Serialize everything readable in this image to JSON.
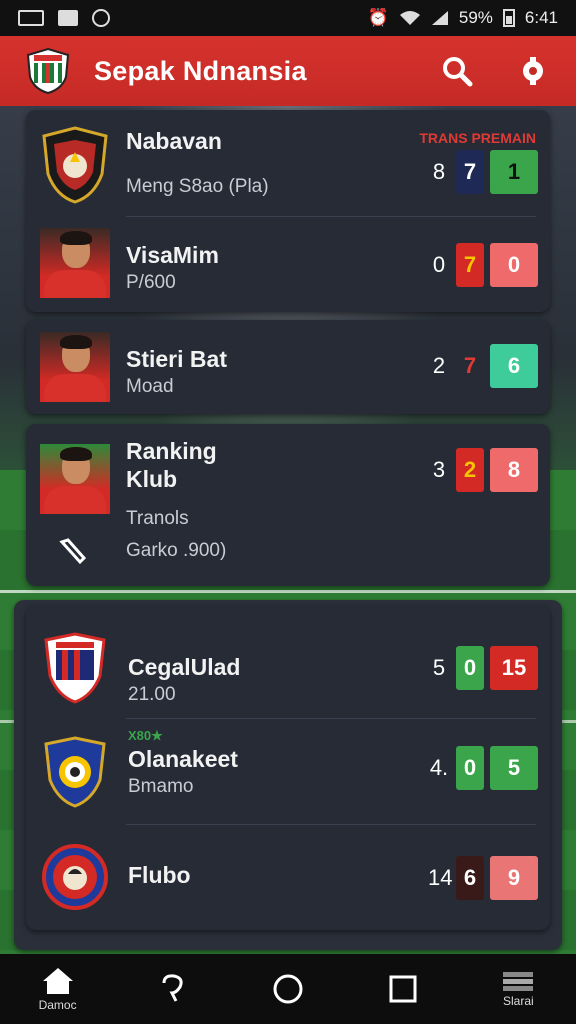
{
  "status_bar": {
    "right_text": "59%",
    "time": "6:41"
  },
  "app_bar": {
    "title": "Sepak  Ndnansia"
  },
  "section_badge": "TRANS PREMAIN",
  "top_rows": [
    {
      "name": "Nabavan",
      "sub": "Meng S8ao (Pla)",
      "num": "8",
      "mid": "7",
      "box": "1",
      "mid_color": "#1e2a55",
      "box_color": "#3aa54a"
    },
    {
      "name": "VisaMim",
      "sub": "P/600",
      "num": "0",
      "mid": "7",
      "box": "0",
      "mid_color": "#d42a25",
      "box_color": "#ef6b6b",
      "mid_text": "#f6c400"
    },
    {
      "name": "Stieri Bat",
      "sub": "Moad",
      "num": "2",
      "mid": "7",
      "box": "6",
      "mid_color": "#262b36",
      "box_color": "#3ecc9a",
      "mid_text": "#e03a35"
    }
  ],
  "ranking": {
    "title_line1": "Ranking",
    "title_line2": "Klub",
    "sub1": "Tranols",
    "sub2": "Garko .900)",
    "num": "3",
    "mid": "2",
    "box": "8",
    "mid_color": "#d42a25",
    "box_color": "#ef6b6b",
    "mid_text": "#f6c400"
  },
  "club_rows": [
    {
      "name": "CegalUlad",
      "sub": "21.00",
      "num": "5",
      "mid": "0",
      "box": "15",
      "mid_color": "#3aa54a",
      "box_color": "#d42a25",
      "tag": ""
    },
    {
      "name": "Olanakeet",
      "sub": "Bmamo",
      "num": "4.",
      "mid": "0",
      "box": "5",
      "mid_color": "#3aa54a",
      "box_color": "#3aa54a",
      "tag": "X80★"
    },
    {
      "name": "Flubo",
      "sub": "",
      "num": "14",
      "mid": "6",
      "box": "9",
      "mid_color": "#3a1a18",
      "box_color": "#ea7575",
      "tag": ""
    }
  ],
  "bottom_nav": {
    "home_label": "Damoc",
    "last_label": "Slarai"
  },
  "colors": {
    "accent": "#d6322d",
    "card": "#262b36"
  }
}
